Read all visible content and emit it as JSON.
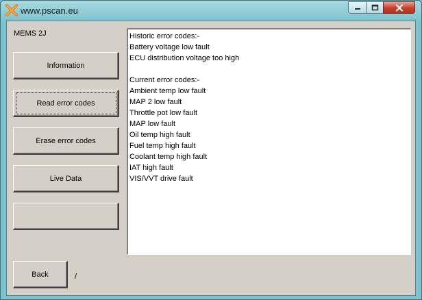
{
  "window": {
    "title": "www.pscan.eu",
    "minimize_icon": "minimize-icon",
    "maximize_icon": "maximize-icon",
    "close_icon": "close-icon",
    "app_icon": "cross-logo-icon"
  },
  "sidebar": {
    "model_label": "MEMS 2J",
    "buttons": [
      {
        "label": "Information"
      },
      {
        "label": "Read error codes"
      },
      {
        "label": "Erase error codes"
      },
      {
        "label": "Live Data"
      },
      {
        "label": ""
      }
    ],
    "back_label": "Back",
    "status_text": "/"
  },
  "output": {
    "lines": [
      "Historic error codes:-",
      "Battery voltage low fault",
      "ECU distribution voltage too high",
      "",
      "Current error codes:-",
      "Ambient temp low fault",
      "MAP 2 low fault",
      "Throttle pot low fault",
      "MAP low fault",
      "Oil temp high fault",
      "Fuel temp high fault",
      "Coolant temp high fault",
      "IAT high fault",
      "VIS/VVT drive fault"
    ]
  },
  "colors": {
    "titlebar": "#7cc3cf",
    "client_bg": "#d4d0c8",
    "close_button": "#c6412a",
    "output_bg": "#ffffff"
  }
}
